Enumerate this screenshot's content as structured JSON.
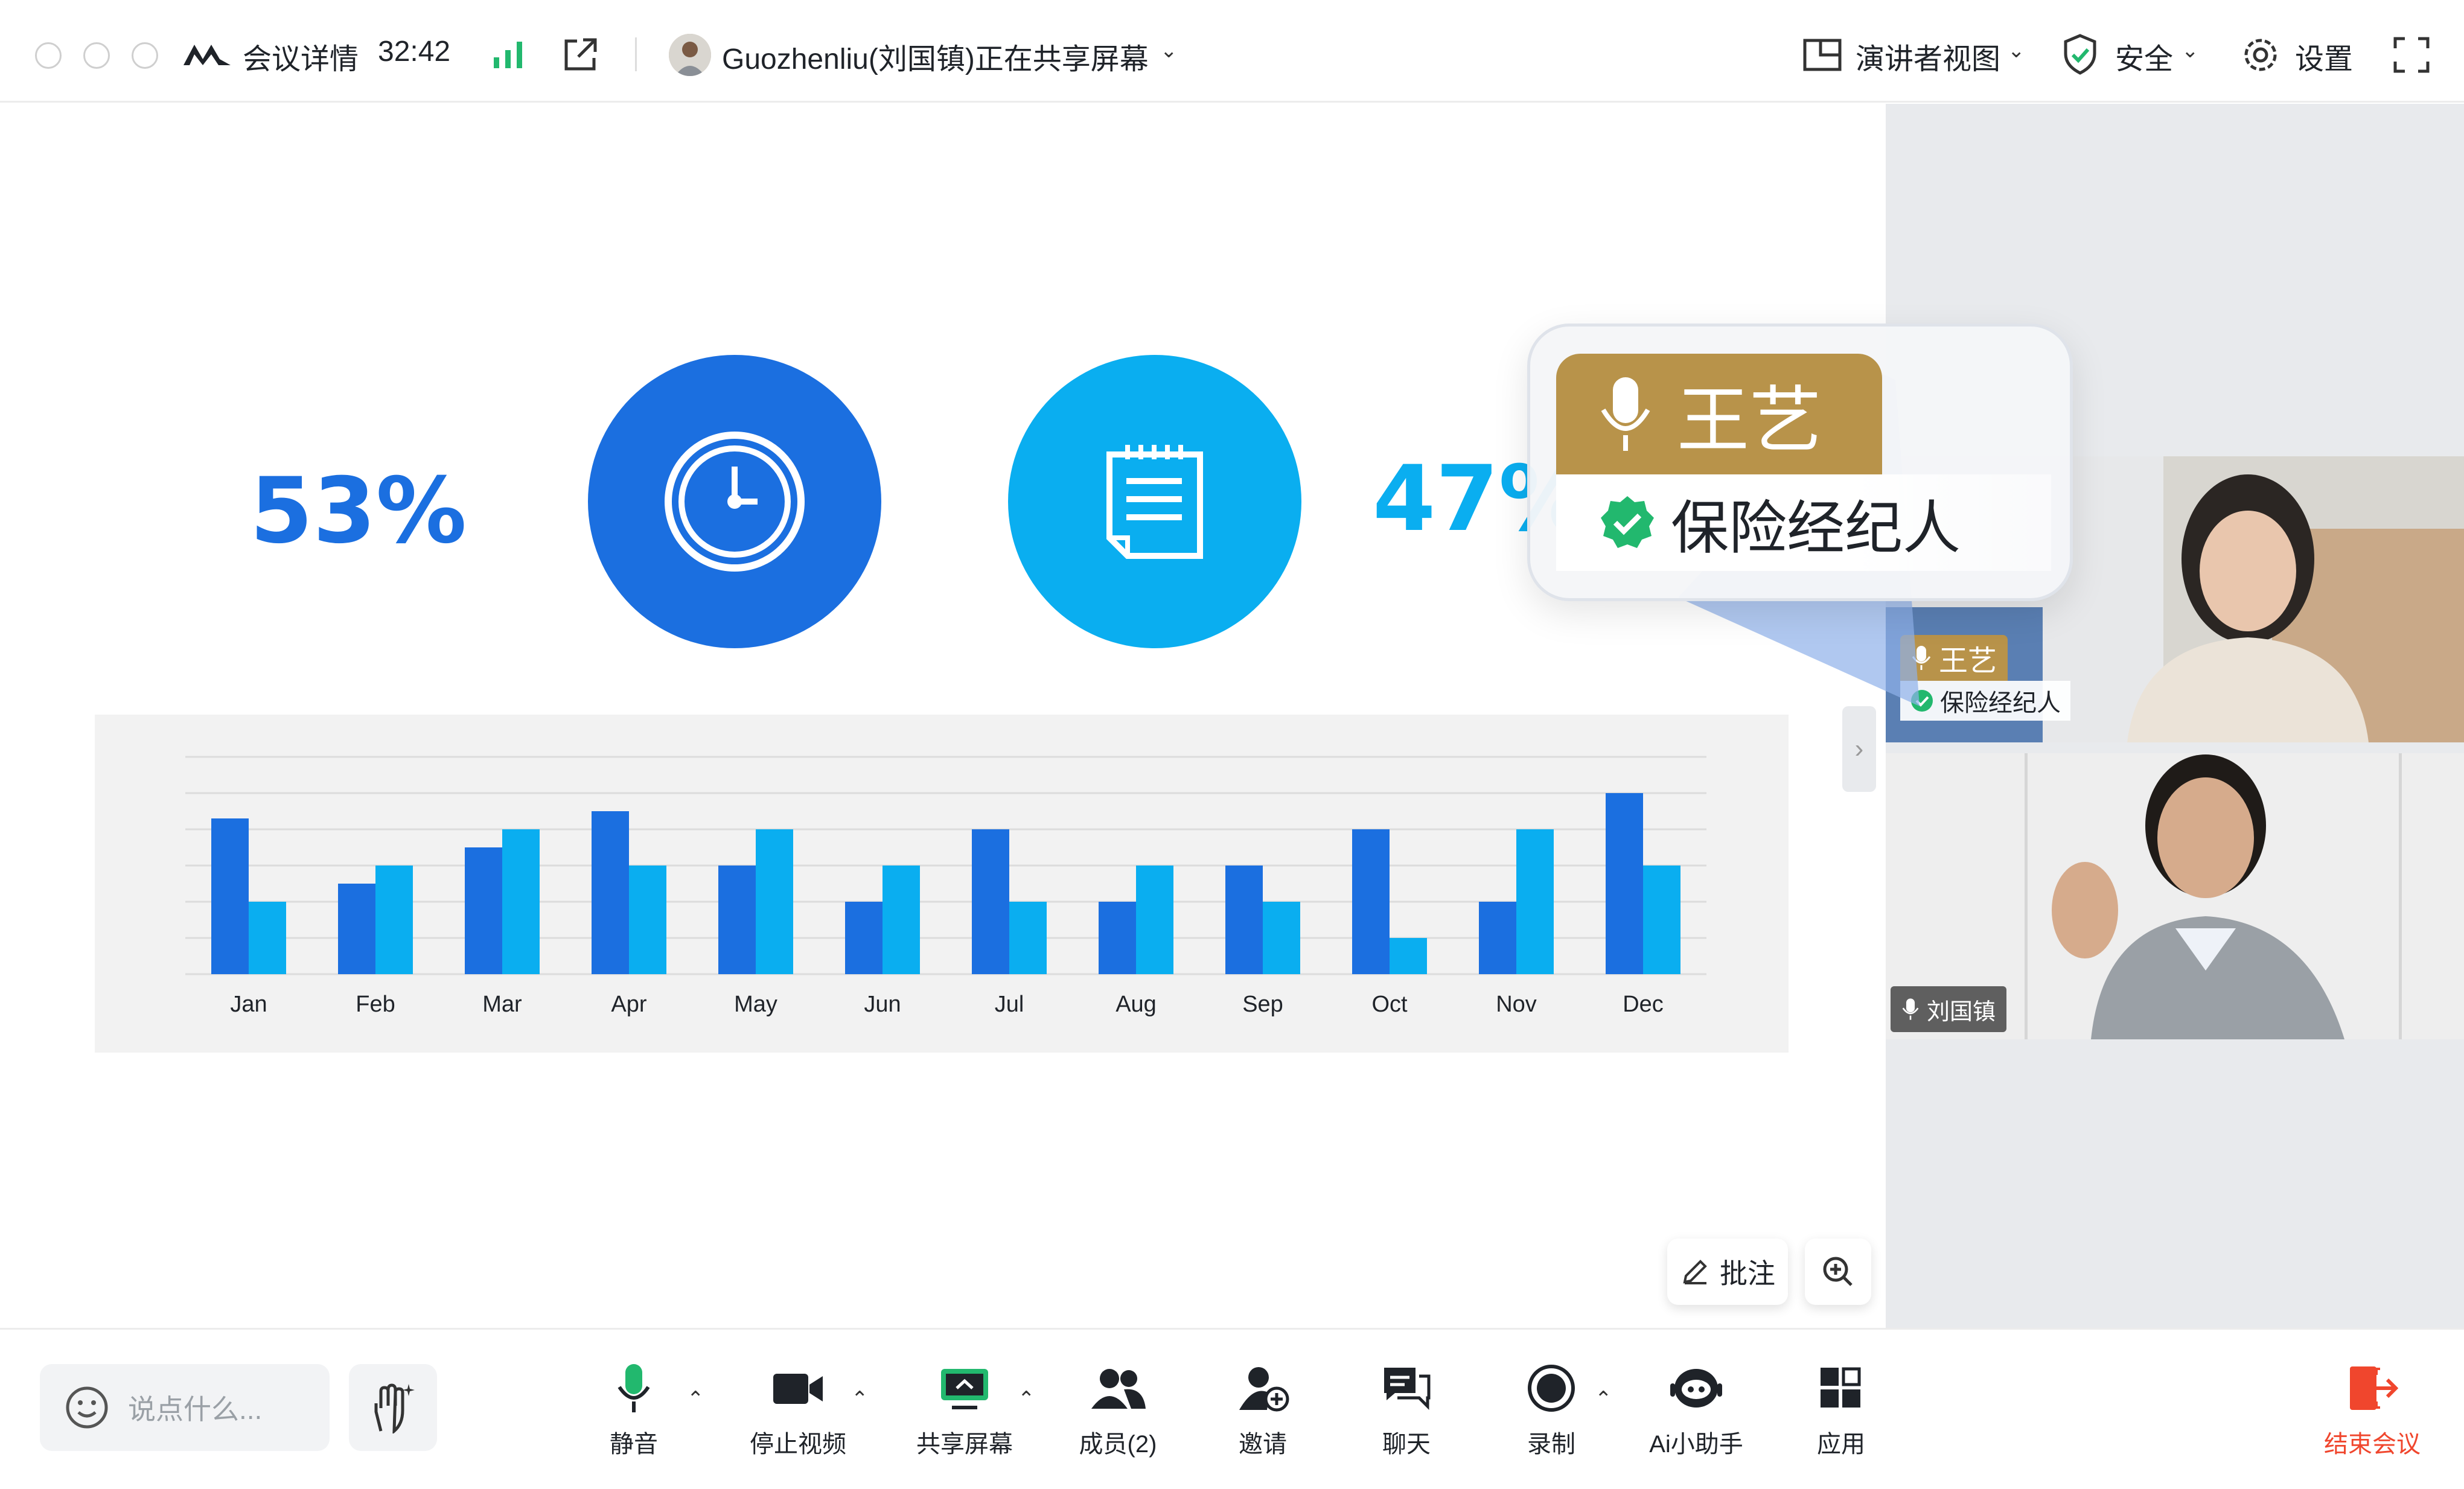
{
  "topbar": {
    "meeting_details": "会议详情",
    "duration": "32:42",
    "sharer_text": "Guozhenliu(刘国镇)正在共享屏幕",
    "presenter_view": "演讲者视图",
    "security": "安全",
    "settings": "设置"
  },
  "slide": {
    "left_percent": "53%",
    "right_percent": "47%",
    "colors": {
      "dark_blue": "#1b6fe0",
      "light_blue": "#0aaef0"
    }
  },
  "chart_data": {
    "type": "bar",
    "categories": [
      "Jan",
      "Feb",
      "Mar",
      "Apr",
      "May",
      "Jun",
      "Jul",
      "Aug",
      "Sep",
      "Oct",
      "Nov",
      "Dec"
    ],
    "series": [
      {
        "values": [
          43,
          25,
          35,
          45,
          30,
          20,
          40,
          20,
          30,
          40,
          20,
          50
        ]
      },
      {
        "values": [
          20,
          30,
          40,
          30,
          40,
          30,
          20,
          30,
          20,
          10,
          40,
          30
        ]
      }
    ],
    "ylim": [
      0,
      60
    ],
    "grid": true,
    "colors": [
      "#1b6fe0",
      "#0aaef0"
    ]
  },
  "callout": {
    "name": "王艺",
    "role": "保险经纪人"
  },
  "participants": [
    {
      "name": "王艺",
      "role": "保险经纪人"
    },
    {
      "name": "刘国镇"
    }
  ],
  "annotate": {
    "label": "批注"
  },
  "bottombar": {
    "chat_placeholder": "说点什么...",
    "tools": {
      "mute": "静音",
      "stop_video": "停止视频",
      "share_screen": "共享屏幕",
      "members": "成员(2)",
      "invite": "邀请",
      "chat": "聊天",
      "record": "录制",
      "ai_assistant": "Ai小助手",
      "apps": "应用"
    },
    "end_meeting": "结束会议"
  },
  "accent": {
    "green": "#22b86e",
    "red": "#f0462d"
  }
}
